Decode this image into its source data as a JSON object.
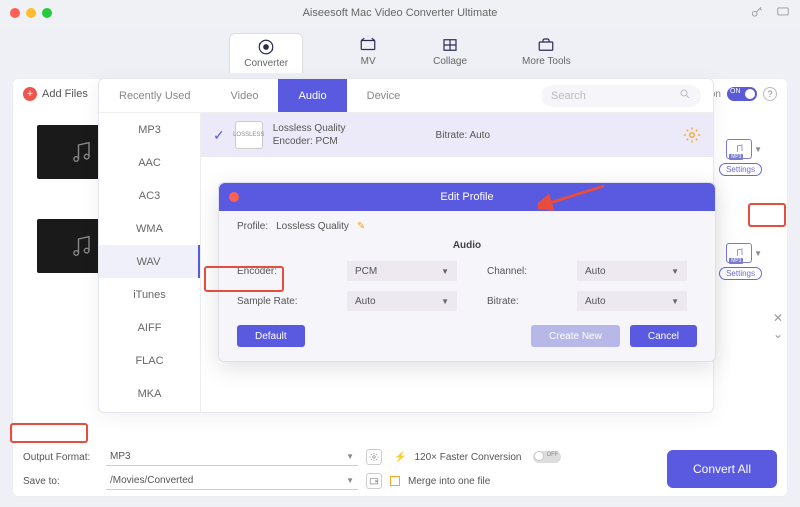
{
  "window": {
    "title": "Aiseesoft Mac Video Converter Ultimate"
  },
  "topnav": {
    "items": [
      "Converter",
      "MV",
      "Collage",
      "More Tools"
    ],
    "active": 0
  },
  "toolbar": {
    "add_label": "Add Files",
    "tion_suffix": "tion",
    "toggle_on": "ON"
  },
  "file_pills": {
    "format_tag": "MP3",
    "settings_label": "Settings"
  },
  "panel": {
    "tabs": [
      "Recently Used",
      "Video",
      "Audio",
      "Device"
    ],
    "active_tab": 2,
    "search_placeholder": "Search",
    "sidebar": [
      "MP3",
      "AAC",
      "AC3",
      "WMA",
      "WAV",
      "iTunes",
      "AIFF",
      "FLAC",
      "MKA"
    ],
    "sidebar_active": 4,
    "profile": {
      "name": "Lossless Quality",
      "encoder_label": "Encoder: PCM",
      "bitrate_label": "Bitrate: Auto",
      "thumb_text": "LOSSLESS"
    }
  },
  "dialog": {
    "title": "Edit Profile",
    "profile_label": "Profile:",
    "profile_value": "Lossless Quality",
    "section": "Audio",
    "fields": {
      "encoder_label": "Encoder:",
      "encoder_value": "PCM",
      "channel_label": "Channel:",
      "channel_value": "Auto",
      "samplerate_label": "Sample Rate:",
      "samplerate_value": "Auto",
      "bitrate_label": "Bitrate:",
      "bitrate_value": "Auto"
    },
    "buttons": {
      "default": "Default",
      "create": "Create New",
      "cancel": "Cancel"
    }
  },
  "bottom": {
    "output_format_label": "Output Format:",
    "output_format_value": "MP3",
    "save_to_label": "Save to:",
    "save_to_value": "/Movies/Converted",
    "faster_label": "120× Faster Conversion",
    "off": "OFF",
    "merge_label": "Merge into one file",
    "convert_all": "Convert All"
  }
}
